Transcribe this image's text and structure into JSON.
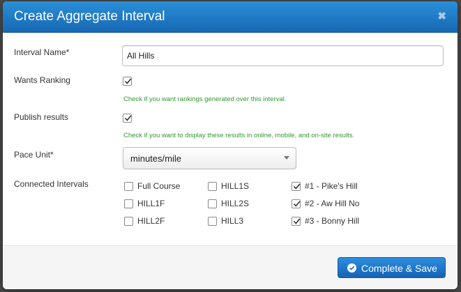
{
  "modal": {
    "title": "Create Aggregate Interval",
    "close_icon": "times-icon"
  },
  "form": {
    "interval_name": {
      "label": "Interval Name*",
      "value": "All Hills"
    },
    "wants_ranking": {
      "label": "Wants Ranking",
      "checked": true,
      "help": "Check if you want rankings generated over this interval."
    },
    "publish_results": {
      "label": "Publish results",
      "checked": true,
      "help": "Check if you want to display these results in online, mobile, and on-site results."
    },
    "pace_unit": {
      "label": "Pace Unit*",
      "value": "minutes/mile"
    },
    "connected_intervals": {
      "label": "Connected Intervals",
      "items": [
        {
          "label": "Full Course",
          "checked": false
        },
        {
          "label": "HILL1F",
          "checked": false
        },
        {
          "label": "HILL2F",
          "checked": false
        },
        {
          "label": "HILL1S",
          "checked": false
        },
        {
          "label": "HILL2S",
          "checked": false
        },
        {
          "label": "HILL3",
          "checked": false
        },
        {
          "label": "#1 - Pike's Hill",
          "checked": true
        },
        {
          "label": "#2 - Aw Hill No",
          "checked": true
        },
        {
          "label": "#3 - Bonny Hill",
          "checked": true
        }
      ]
    }
  },
  "footer": {
    "save_label": "Complete & Save",
    "save_icon": "check-circle-icon"
  },
  "colors": {
    "header": "#1a75c4",
    "button": "#1a70c4",
    "help_text": "#2e9a2e"
  }
}
